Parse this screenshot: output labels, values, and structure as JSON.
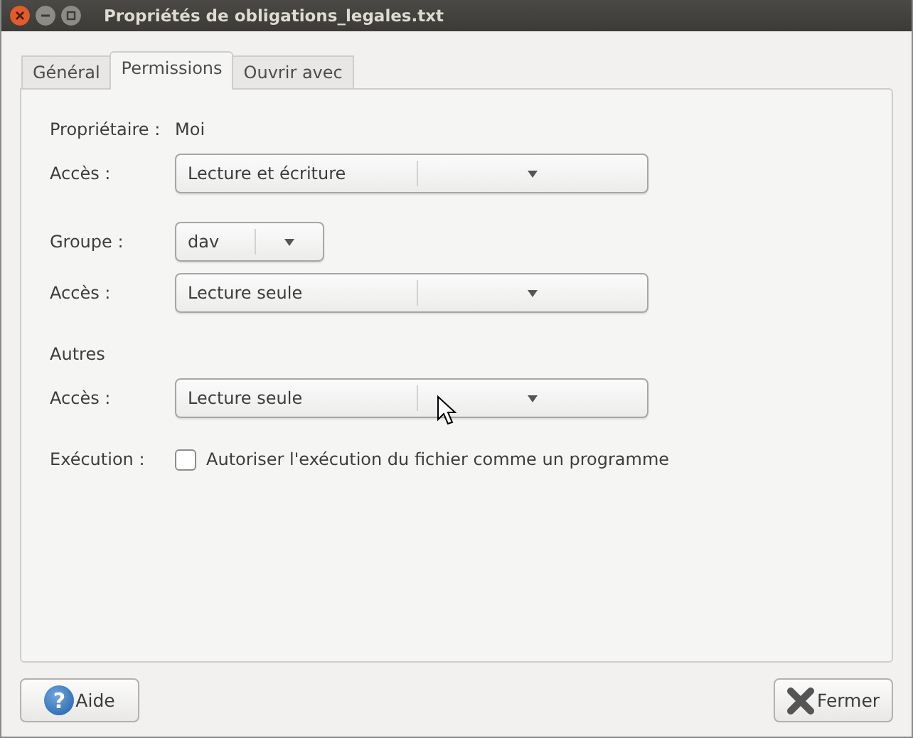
{
  "window": {
    "title": "Propriétés de obligations_legales.txt"
  },
  "tabs": [
    {
      "label": "Général",
      "selected": false
    },
    {
      "label": "Permissions",
      "selected": true
    },
    {
      "label": "Ouvrir avec",
      "selected": false
    }
  ],
  "sections": [
    {
      "rows": [
        {
          "kind": "text",
          "label": "Propriétaire :",
          "value": "Moi"
        },
        {
          "kind": "combo",
          "label": "Accès :",
          "value": "Lecture et écriture"
        }
      ]
    },
    {
      "rows": [
        {
          "kind": "short-combo",
          "label": "Groupe :",
          "value": "dav"
        },
        {
          "kind": "combo",
          "label": "Accès :",
          "value": "Lecture seule"
        }
      ]
    },
    {
      "heading": "Autres",
      "rows": [
        {
          "kind": "combo",
          "label": "Accès :",
          "value": "Lecture seule"
        }
      ]
    },
    {
      "rows": [
        {
          "kind": "checkbox",
          "label": "Exécution :",
          "value": "Autoriser l'exécution du fichier comme un programme",
          "checked": false
        }
      ]
    }
  ],
  "buttons": [
    {
      "kind": "help",
      "icon": "?",
      "label": "Aide"
    },
    {
      "kind": "close",
      "label": "Fermer"
    }
  ]
}
